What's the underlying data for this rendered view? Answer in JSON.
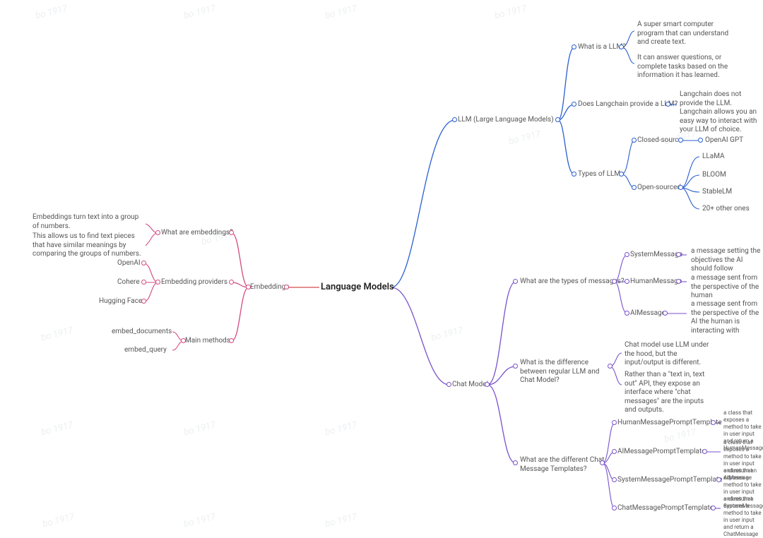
{
  "watermark_text": "bo 1917",
  "center": "Language Models",
  "llm": {
    "label": "LLM (Large Language Models)",
    "what": {
      "label": "What is a LLM?",
      "a1": "A super smart computer program that can understand and create text.",
      "a2": "It can answer questions, or complete tasks based on the information it has learned."
    },
    "provide": {
      "label": "Does Langchain provide a LLM?",
      "a": "Langchain does not provide the LLM. Langchain allows you an easy way to interact with your LLM of choice."
    },
    "types": {
      "label": "Types of LLMs",
      "closed": {
        "label": "Closed-source",
        "item": "OpenAI GPT"
      },
      "open": {
        "label": "Open-sourced",
        "items": [
          "LLaMA",
          "BLOOM",
          "StableLM",
          "20+ other ones"
        ]
      }
    }
  },
  "chat": {
    "label": "Chat Model",
    "msgs": {
      "label": "What are the types of messages?",
      "system": {
        "label": "SystemMessage",
        "desc": "a message setting the objectives the AI should follow"
      },
      "human": {
        "label": "HumanMessage",
        "desc": "a message sent from the perspective of the human"
      },
      "ai": {
        "label": "AIMessage",
        "desc": "a message sent from the perspective of the AI the human is interacting with"
      }
    },
    "diff": {
      "label": "What is the difference between regular LLM and Chat Model?",
      "a1": "Chat model use LLM under the hood, but the input/output is different.",
      "a2": "Rather than a \"text in, text out\" API, they expose an interface where \"chat messages\" are the inputs and outputs."
    },
    "tmpl": {
      "label": "What are the different Chat Message Templates?",
      "human": {
        "label": "HumanMessagePromptTemplate",
        "desc": "a class that exposes a method to take in user input and return a HumanMessage"
      },
      "ai": {
        "label": "AIMessagePromptTemplate",
        "desc": "a class that exposes a method to take in user input and return an AIMessage"
      },
      "system": {
        "label": "SystemMessagePromptTemplate",
        "desc": "a class that exposes a method to take in user input and return a SystemMessage"
      },
      "chat": {
        "label": "ChatMessagePromptTemplate",
        "desc": "a class that exposes a method to take in user input and return a ChatMessage"
      }
    }
  },
  "emb": {
    "label": "Embeddings",
    "what": {
      "label": "What are embeddings?",
      "a1": "Embeddings turn text into a group of numbers.",
      "a2": "This allows us to find text pieces that have similar meanings by comparing the groups of numbers."
    },
    "providers": {
      "label": "Embedding providers",
      "items": [
        "OpenAI",
        "Cohere",
        "Hugging Face"
      ]
    },
    "methods": {
      "label": "Main methods",
      "items": [
        "embed_documents",
        "embed_query"
      ]
    }
  }
}
